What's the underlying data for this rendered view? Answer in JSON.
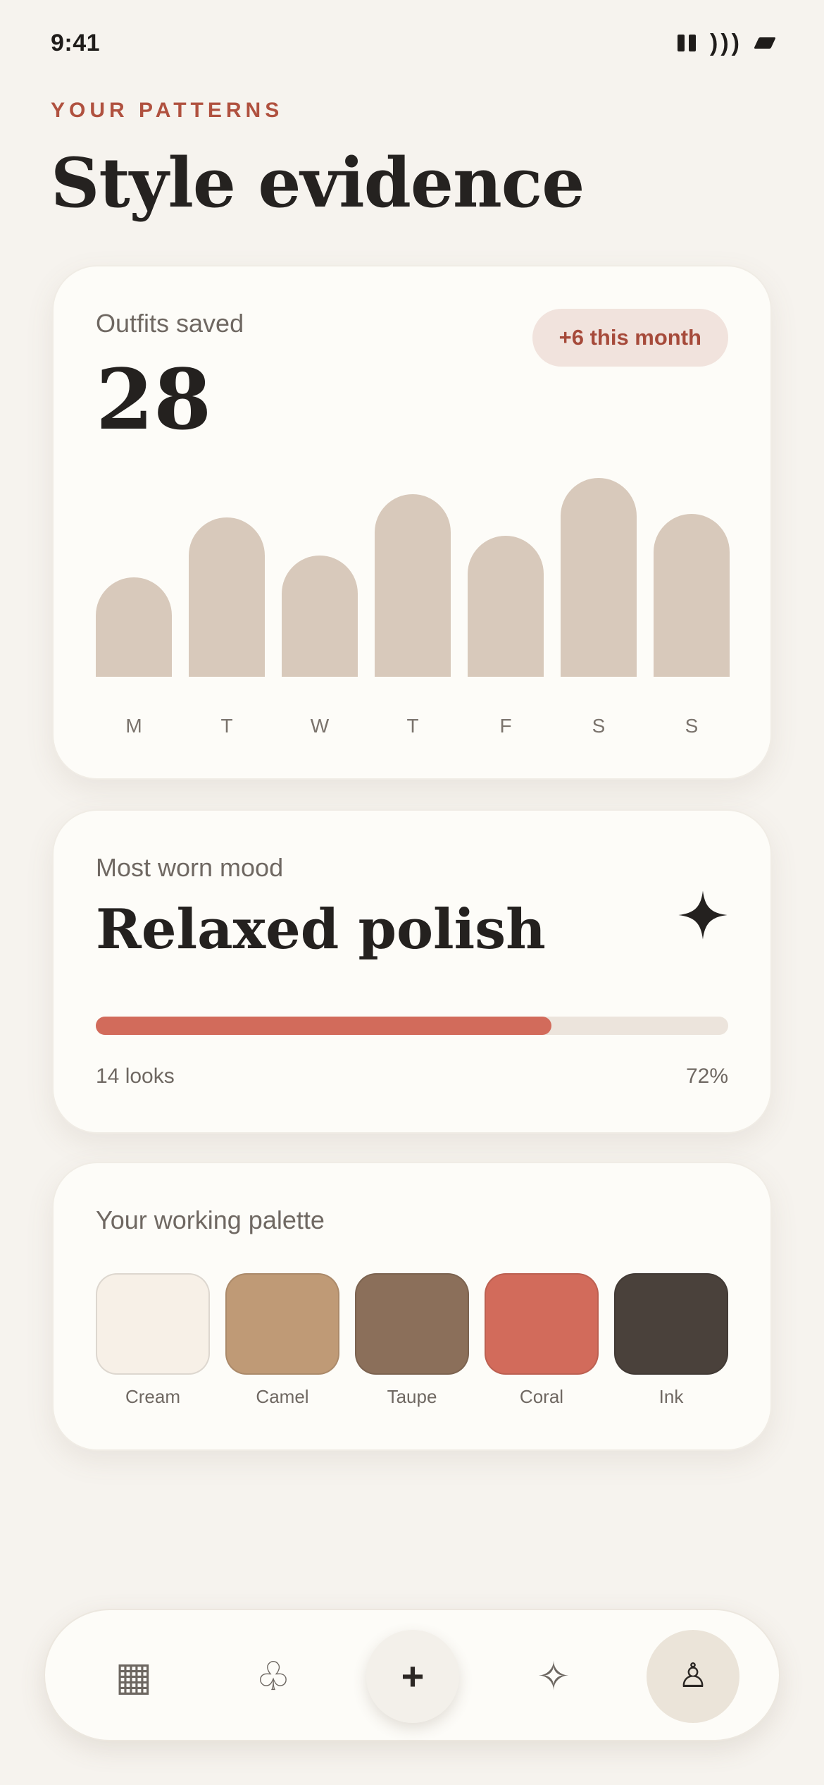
{
  "status_bar": {
    "time": "9:41",
    "wifi_icon": "wifi-icon",
    "signal_icon": "signal-icon",
    "battery_icon": "battery-icon"
  },
  "header": {
    "eyebrow": "YOUR PATTERNS",
    "title": "Style evidence"
  },
  "outfits_card": {
    "label": "Outfits saved",
    "count": "28",
    "badge": "+6 this month",
    "bar_color": "#d8c9bb",
    "days": [
      {
        "label": "M",
        "value": 0.5
      },
      {
        "label": "T",
        "value": 0.8
      },
      {
        "label": "W",
        "value": 0.61
      },
      {
        "label": "T",
        "value": 0.92
      },
      {
        "label": "F",
        "value": 0.71
      },
      {
        "label": "S",
        "value": 1.0
      },
      {
        "label": "S",
        "value": 0.82
      }
    ]
  },
  "mood_card": {
    "label": "Most worn mood",
    "mood": "Relaxed polish",
    "icon": "sparkle-icon",
    "looks": "14 looks",
    "percent_label": "72%",
    "percent": 72,
    "accent": "#d26b5b"
  },
  "palette_card": {
    "label": "Your working palette",
    "swatches": [
      {
        "name": "Cream",
        "color": "#f7f0e7"
      },
      {
        "name": "Camel",
        "color": "#bf9a76"
      },
      {
        "name": "Taupe",
        "color": "#8b6f5a"
      },
      {
        "name": "Coral",
        "color": "#d26b5b"
      },
      {
        "name": "Ink",
        "color": "#4a413b"
      }
    ]
  },
  "nav": {
    "items": [
      {
        "name": "grid-icon",
        "glyph": "▦"
      },
      {
        "name": "club-icon",
        "glyph": "♧"
      },
      {
        "name": "add-icon",
        "glyph": "+"
      },
      {
        "name": "sparkle-outline-icon",
        "glyph": "✧"
      },
      {
        "name": "profile-icon",
        "glyph": "♙"
      }
    ]
  }
}
